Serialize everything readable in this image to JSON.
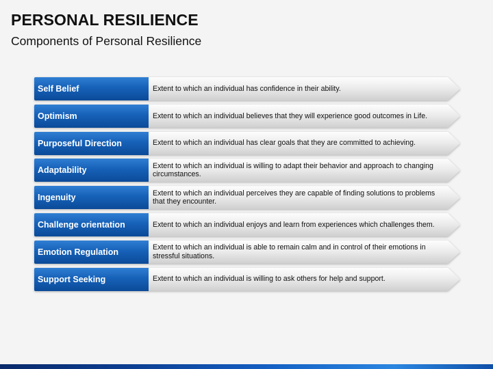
{
  "slide": {
    "title": "PERSONAL RESILIENCE",
    "subtitle": "Components of Personal Resilience"
  },
  "components": [
    {
      "label": "Self Belief",
      "description": "Extent to which an individual has confidence in their ability."
    },
    {
      "label": "Optimism",
      "description": "Extent to which an individual believes that they will experience good outcomes in Life."
    },
    {
      "label": "Purposeful Direction",
      "description": "Extent to which an individual has clear goals that they are committed to achieving."
    },
    {
      "label": "Adaptability",
      "description": "Extent to which an individual is willing to adapt their behavior and approach to changing circumstances."
    },
    {
      "label": "Ingenuity",
      "description": "Extent to which an individual perceives they are capable of finding solutions to problems that they encounter."
    },
    {
      "label": "Challenge orientation",
      "description": "Extent to which an individual enjoys and learn from experiences which challenges them."
    },
    {
      "label": "Emotion Regulation",
      "description": "Extent to which an individual is able to remain calm and in control of their emotions in stressful situations."
    },
    {
      "label": "Support Seeking",
      "description": "Extent to which an individual is willing to ask others for help and support."
    }
  ],
  "colors": {
    "label_blue": "#1661b8",
    "arrow_gray": "#e0e0e0",
    "background": "#f4f4f4",
    "footer_bar": "#1560c4"
  }
}
